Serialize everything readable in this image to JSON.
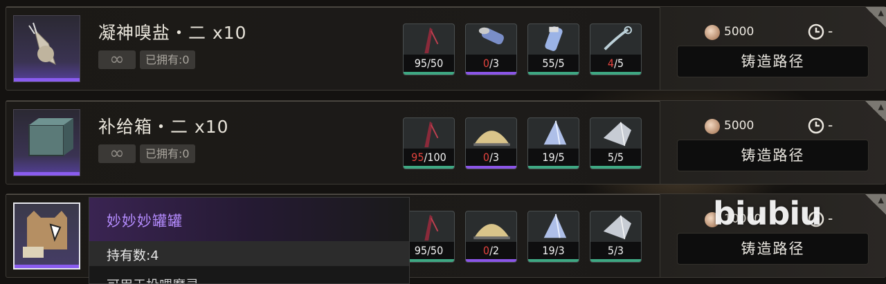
{
  "rows": [
    {
      "name": "凝神嗅盐・二 x10",
      "infinite": "∞",
      "owned": "已拥有:0",
      "materials": [
        {
          "icon": "feather-blade-icon",
          "have": "95",
          "need": "/50",
          "short": false,
          "underline": "green"
        },
        {
          "icon": "vial-icon",
          "have": "0",
          "need": "/3",
          "short": true,
          "underline": "purple"
        },
        {
          "icon": "crystal-tube-icon",
          "have": "55",
          "need": "/5",
          "short": false,
          "underline": "green"
        },
        {
          "icon": "chain-hook-icon",
          "have": "4",
          "need": "/5",
          "short": true,
          "underline": "green"
        }
      ],
      "cost": "5000",
      "time": "-",
      "forge": "铸造路径"
    },
    {
      "name": "补给箱・二 x10",
      "infinite": "∞",
      "owned": "已拥有:0",
      "materials": [
        {
          "icon": "feather-blade-icon",
          "have": "95",
          "need": "/100",
          "short": true,
          "underline": "green"
        },
        {
          "icon": "sand-pile-icon",
          "have": "0",
          "need": "/3",
          "short": true,
          "underline": "purple"
        },
        {
          "icon": "crystal-shard-icon",
          "have": "19",
          "need": "/5",
          "short": false,
          "underline": "green"
        },
        {
          "icon": "metal-shard-icon",
          "have": "5",
          "need": "/5",
          "short": false,
          "underline": "green"
        }
      ],
      "cost": "5000",
      "time": "-",
      "forge": "铸造路径"
    },
    {
      "materials": [
        {
          "icon": "feather-blade-icon",
          "have": "95",
          "need": "/50",
          "short": false,
          "underline": "green"
        },
        {
          "icon": "sand-pile-icon",
          "have": "0",
          "need": "/2",
          "short": true,
          "underline": "purple"
        },
        {
          "icon": "crystal-shard-icon",
          "have": "19",
          "need": "/3",
          "short": false,
          "underline": "green"
        },
        {
          "icon": "metal-shard-icon",
          "have": "5",
          "need": "/3",
          "short": false,
          "underline": "green"
        }
      ],
      "cost": "10000",
      "time": "-",
      "forge": "铸造路径"
    }
  ],
  "tooltip": {
    "title": "妙妙妙罐罐",
    "owned": "持有数:4",
    "desc": "可用于投喂魔灵"
  },
  "watermark": "biubiu",
  "colors": {
    "accent_purple": "#8b55e8",
    "accent_green": "#3ea883",
    "shortage_red": "#e2433e",
    "tooltip_title": "#b58cff"
  }
}
